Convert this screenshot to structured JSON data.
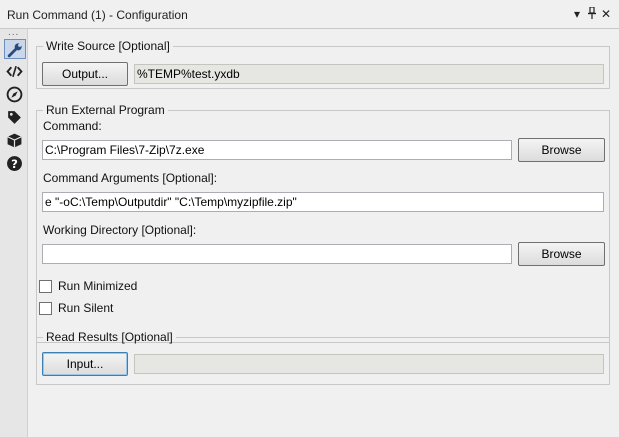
{
  "window": {
    "title": "Run Command (1) - Configuration",
    "controls": {
      "dropdown": "▾",
      "pin": "⊥",
      "close": "✕"
    }
  },
  "sidebar": {
    "dots": "...",
    "items": [
      {
        "icon": "wrench-icon",
        "active": true
      },
      {
        "icon": "code-icon",
        "active": false
      },
      {
        "icon": "navigation-icon",
        "active": false
      },
      {
        "icon": "tag-icon",
        "active": false
      },
      {
        "icon": "box-icon",
        "active": false
      },
      {
        "icon": "help-icon",
        "active": false
      }
    ]
  },
  "write_source": {
    "legend": "Write Source [Optional]",
    "output_button": "Output...",
    "output_value": "%TEMP%test.yxdb"
  },
  "run_external": {
    "legend": "Run External Program",
    "command_label": "Command:",
    "command_value": "C:\\Program Files\\7-Zip\\7z.exe",
    "browse_button": "Browse",
    "args_label": "Command Arguments [Optional]:",
    "args_value": "e \"-oC:\\Temp\\Outputdir\" \"C:\\Temp\\myzipfile.zip\"",
    "workdir_label": "Working Directory [Optional]:",
    "workdir_value": "",
    "workdir_browse_button": "Browse",
    "run_minimized_label": "Run Minimized",
    "run_minimized_checked": false,
    "run_silent_label": "Run Silent",
    "run_silent_checked": false
  },
  "read_results": {
    "legend": "Read Results [Optional]",
    "input_button": "Input...",
    "input_value": ""
  },
  "colors": {
    "background": "#f0f0f0",
    "active_tool": "#c9d7ea",
    "readonly_field": "#e6e6e2"
  }
}
